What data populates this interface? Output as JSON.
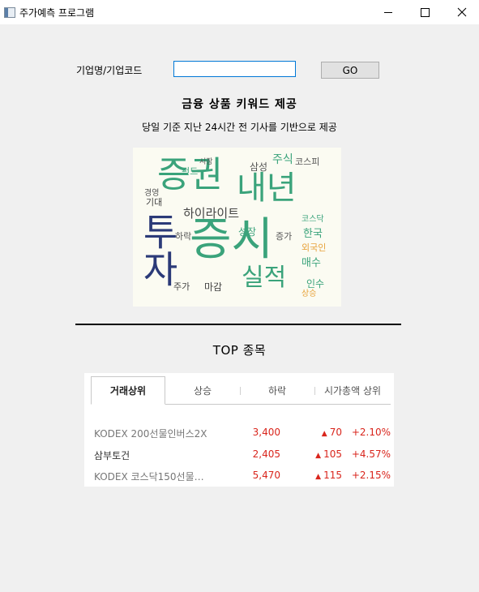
{
  "window": {
    "title": "주가예측 프로그램"
  },
  "form": {
    "company_label": "기업명/기업코드",
    "input_value": "",
    "go_label": "GO"
  },
  "keywords": {
    "heading": "금융 상품 키워드 제공",
    "subtitle": "당일 기준 지난 24시간 전 기사를 기반으로 제공",
    "cloud_words": [
      "증권",
      "증시",
      "내년",
      "투자",
      "실적",
      "하이라이트",
      "주식",
      "코스피",
      "삼성",
      "한국",
      "매수",
      "인수",
      "마감",
      "하락",
      "주가",
      "기대",
      "펀드",
      "경영",
      "성장",
      "코스닥",
      "증가",
      "외국인",
      "상승",
      "시장"
    ]
  },
  "top": {
    "heading": "TOP 종목",
    "tabs": [
      "거래상위",
      "상승",
      "하락",
      "시가총액 상위"
    ],
    "rows": [
      {
        "name": "KODEX 200선물인버스2X",
        "price": "3,400",
        "change": "70",
        "rate": "+2.10%"
      },
      {
        "name": "삼부토건",
        "price": "2,405",
        "change": "105",
        "rate": "+4.57%"
      },
      {
        "name": "KODEX 코스닥150선물…",
        "price": "5,470",
        "change": "115",
        "rate": "+2.15%"
      }
    ],
    "up_glyph": "▲"
  },
  "colors": {
    "accent": "#0078d7",
    "up": "#d9251c",
    "cloud_green": "#3aa37b",
    "cloud_navy": "#2b3a78"
  }
}
